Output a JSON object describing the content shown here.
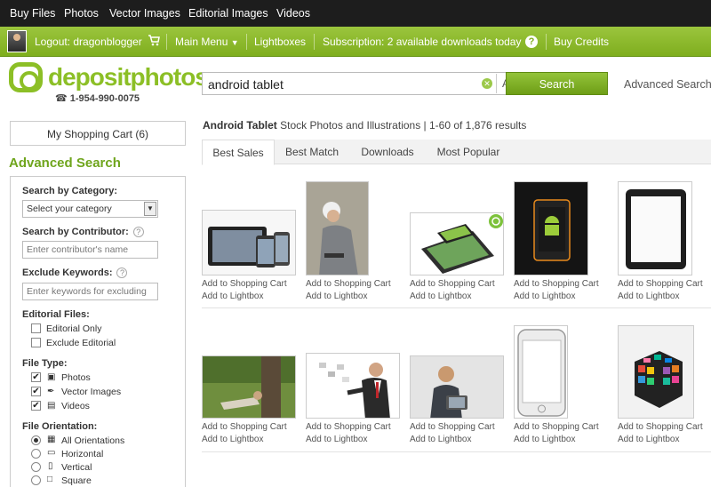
{
  "topnav": {
    "buy_files": "Buy Files",
    "photos": "Photos",
    "vector_images": "Vector Images",
    "editorial_images": "Editorial Images",
    "videos": "Videos"
  },
  "userbar": {
    "logout": "Logout: dragonblogger",
    "main_menu": "Main Menu",
    "lightboxes": "Lightboxes",
    "subscription": "Subscription: 2 available downloads today",
    "buy_credits": "Buy Credits"
  },
  "brand": {
    "logo_text": "depositphotos",
    "phone": "1-954-990-0075",
    "accent": "#8cbf26"
  },
  "search": {
    "value": "android tablet",
    "file_type": "All Files",
    "button": "Search",
    "advanced_link": "Advanced Search"
  },
  "sidebar": {
    "cart": "My Shopping Cart (6)",
    "title": "Advanced Search",
    "category_label": "Search by Category:",
    "category_select": "Select your category",
    "contributor_label": "Search by Contributor:",
    "contributor_placeholder": "Enter contributor's name",
    "exclude_label": "Exclude Keywords:",
    "exclude_placeholder": "Enter keywords for excluding",
    "editorial_label": "Editorial Files:",
    "editorial_options": [
      {
        "label": "Editorial Only",
        "checked": false
      },
      {
        "label": "Exclude Editorial",
        "checked": false
      }
    ],
    "filetype_label": "File Type:",
    "filetype_options": [
      {
        "label": "Photos",
        "checked": true,
        "icon": "camera-icon"
      },
      {
        "label": "Vector Images",
        "checked": true,
        "icon": "pen-icon"
      },
      {
        "label": "Videos",
        "checked": true,
        "icon": "clapper-icon"
      }
    ],
    "orientation_label": "File Orientation:",
    "orientation_options": [
      {
        "label": "All Orientations",
        "selected": true
      },
      {
        "label": "Horizontal",
        "selected": false
      },
      {
        "label": "Vertical",
        "selected": false
      },
      {
        "label": "Square",
        "selected": false
      }
    ]
  },
  "results": {
    "query_title": "Android Tablet",
    "summary": " Stock Photos and Illustrations | 1-60 of 1,876 results",
    "tabs": [
      "Best Sales",
      "Best Match",
      "Downloads",
      "Most Popular"
    ],
    "active_tab": "Best Sales",
    "add_cart": "Add to Shopping Cart",
    "add_lightbox": "Add to Lightbox",
    "items": [
      {
        "subject": "tablet-and-phones"
      },
      {
        "subject": "woman-with-tablet"
      },
      {
        "subject": "tablets-stack"
      },
      {
        "subject": "android-phone-dark"
      },
      {
        "subject": "black-tablet"
      },
      {
        "subject": "man-under-tree"
      },
      {
        "subject": "businessman-flying-papers"
      },
      {
        "subject": "businessman-with-tablet"
      },
      {
        "subject": "white-phone"
      },
      {
        "subject": "app-cube"
      }
    ]
  }
}
